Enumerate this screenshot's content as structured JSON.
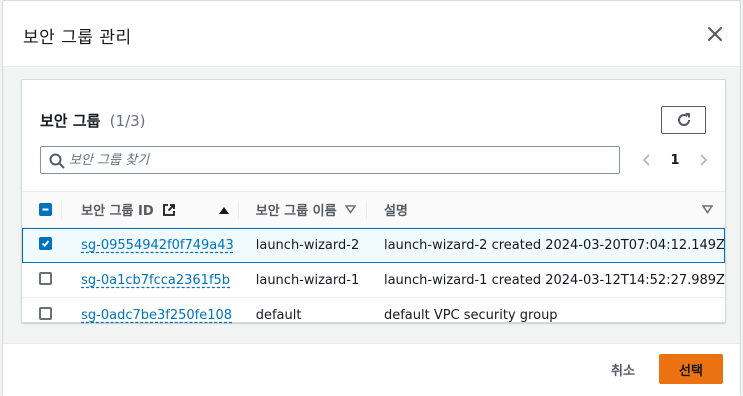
{
  "modal": {
    "title": "보안 그룹 관리"
  },
  "panel": {
    "title": "보안 그룹",
    "count": "(1/3)"
  },
  "search": {
    "placeholder": "보안 그룹 찾기"
  },
  "pager": {
    "current_page": "1"
  },
  "table": {
    "columns": {
      "id": "보안 그룹 ID",
      "name": "보안 그룹 이름",
      "description": "설명"
    },
    "rows": [
      {
        "id": "sg-09554942f0f749a43",
        "name": "launch-wizard-2",
        "description": "launch-wizard-2 created 2024-03-20T07:04:12.149Z",
        "selected": true
      },
      {
        "id": "sg-0a1cb7fcca2361f5b",
        "name": "launch-wizard-1",
        "description": "launch-wizard-1 created 2024-03-12T14:52:27.989Z",
        "selected": false
      },
      {
        "id": "sg-0adc7be3f250fe108",
        "name": "default",
        "description": "default VPC security group",
        "selected": false
      }
    ]
  },
  "footer": {
    "cancel_label": "취소",
    "select_label": "선택"
  },
  "colors": {
    "primary_button": "#ec7211",
    "link": "#0073bb",
    "selected_row_bg": "#f1faff"
  }
}
